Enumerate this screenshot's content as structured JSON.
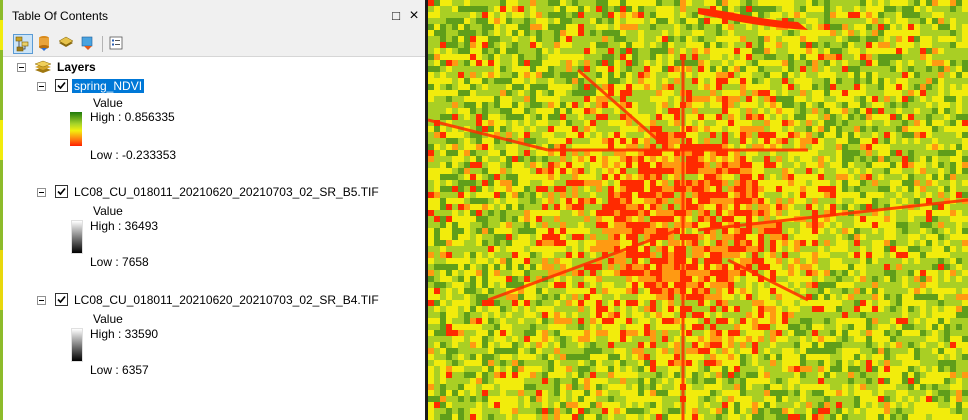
{
  "window": {
    "title": "Table Of Contents",
    "buttons": {
      "maximize": "□",
      "close": "×"
    }
  },
  "toolbar": {
    "tools": [
      {
        "icon": "list-by-drawing-order-icon",
        "active": true
      },
      {
        "icon": "list-by-source-icon",
        "active": false
      },
      {
        "icon": "list-by-visibility-icon",
        "active": false
      },
      {
        "icon": "list-by-selection-icon",
        "active": false
      },
      {
        "icon": "options-icon",
        "active": false
      }
    ]
  },
  "toc": {
    "root_label": "Layers",
    "layers": [
      {
        "name": "spring_NDVI",
        "checked": true,
        "selected": true,
        "legend_title": "Value",
        "high": "High : 0.856335",
        "low": "Low : -0.233353",
        "ramp": "ndvi",
        "ramp_colors": [
          "#1f7a0c",
          "#a7d42a",
          "#f4f00d",
          "#ff7f10",
          "#ff1e00"
        ]
      },
      {
        "name": "LC08_CU_018011_20210620_20210703_02_SR_B5.TIF",
        "checked": true,
        "selected": false,
        "legend_title": "Value",
        "high": "High : 36493",
        "low": "Low : 7658",
        "ramp": "gray"
      },
      {
        "name": "LC08_CU_018011_20210620_20210703_02_SR_B4.TIF",
        "checked": true,
        "selected": false,
        "legend_title": "Value",
        "high": "High : 33590",
        "low": "Low : 6357",
        "ramp": "gray"
      }
    ]
  },
  "map": {
    "content": "NDVI raster rendered with red-yellow-green color ramp",
    "colors": {
      "green": "#5f9e1a",
      "light_green": "#a9cf24",
      "yellow": "#f2ec0c",
      "orange": "#ff9a12",
      "red": "#ff2a00"
    }
  }
}
